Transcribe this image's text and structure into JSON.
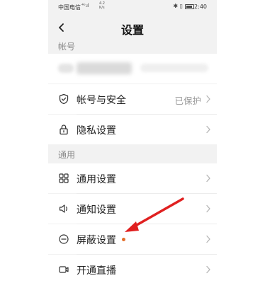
{
  "status_bar": {
    "carrier": "中国电信",
    "signal": "⁴ᴳ.ıl",
    "net_speed_value": "4.2",
    "net_speed_unit": "K/s",
    "time": "2:40"
  },
  "header": {
    "title": "设置"
  },
  "sections": {
    "account_header": "帐号",
    "general_header": "通用"
  },
  "rows": {
    "security": {
      "label": "帐号与安全",
      "value": "已保护"
    },
    "privacy": {
      "label": "隐私设置"
    },
    "general": {
      "label": "通用设置"
    },
    "notify": {
      "label": "通知设置"
    },
    "block": {
      "label": "屏蔽设置"
    },
    "live": {
      "label": "开通直播"
    }
  },
  "colors": {
    "annotation_arrow": "#e02020",
    "notification_dot": "#e46e2a"
  }
}
